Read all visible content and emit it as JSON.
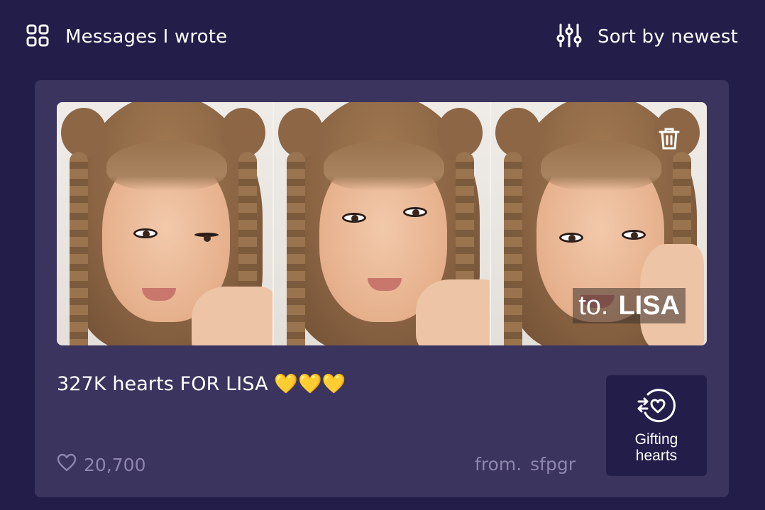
{
  "header": {
    "filter_label": "Messages I wrote",
    "sort_label": "Sort by newest"
  },
  "card": {
    "recipient_prefix": "to.",
    "recipient_name": "LISA",
    "message": "327K hearts FOR LISA 💛💛💛",
    "like_count": "20,700",
    "from_prefix": "from.",
    "from_name": "sfpgr",
    "gift_button_line1": "Gifting",
    "gift_button_line2": "hearts"
  },
  "icons": {
    "filter": "grid-icon",
    "sort": "sliders-icon",
    "delete": "trash-icon",
    "like": "heart-outline-icon",
    "gift": "heart-exchange-icon"
  },
  "colors": {
    "background": "#231d4a",
    "card": "#3b345f",
    "muted_text": "#8e86ad",
    "heart_emoji": "#f6c21a"
  }
}
